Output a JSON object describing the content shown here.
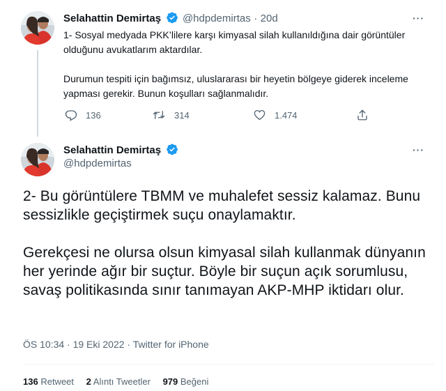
{
  "tweet1": {
    "author_name": "Selahattin Demirtaş",
    "author_handle": "@hdpdemirtas",
    "separator": "·",
    "time": "20d",
    "more_label": "···",
    "paragraphs": [
      "1-  Sosyal medyada PKK’lilere karşı kimyasal silah kullanıldığına dair görüntüler olduğunu avukatlarım aktardılar.",
      "Durumun tespiti için bağımsız, uluslararası bir heyetin bölgeye giderek inceleme yapması gerekir. Bunun koşulları sağlanmalıdır."
    ],
    "actions": {
      "reply_count": "136",
      "retweet_count": "314",
      "like_count": "1.474"
    }
  },
  "tweet2": {
    "author_name": "Selahattin Demirtaş",
    "author_handle": "@hdpdemirtas",
    "more_label": "···",
    "paragraphs": [
      "2- Bu görüntülere TBMM ve muhalefet sessiz kalamaz. Bunu sessizlikle geçiştirmek suçu onaylamaktır.",
      "Gerekçesi ne olursa olsun kimyasal silah kullanmak dünyanın her yerinde ağır bir suçtur. Böyle bir suçun açık sorumlusu, savaş politikasında sınır tanımayan AKP-MHP iktidarı olur."
    ],
    "meta": "ÖS 10:34 · 19 Eki 2022 · Twitter for iPhone",
    "stats": {
      "retweets_count": "136",
      "retweets_label": "Retweet",
      "quotes_count": "2",
      "quotes_label": "Alıntı Tweetler",
      "likes_count": "979",
      "likes_label": "Beğeni"
    }
  },
  "icons": {
    "verified": "verified-badge-icon",
    "reply": "reply-icon",
    "retweet": "retweet-icon",
    "like": "heart-icon",
    "share": "share-icon",
    "more": "more-options-icon"
  },
  "colors": {
    "verified_blue": "#1d9bf0",
    "text_primary": "#0f1419",
    "text_secondary": "#536471",
    "thread_line": "#cfd9de",
    "divider": "#eff3f4"
  }
}
